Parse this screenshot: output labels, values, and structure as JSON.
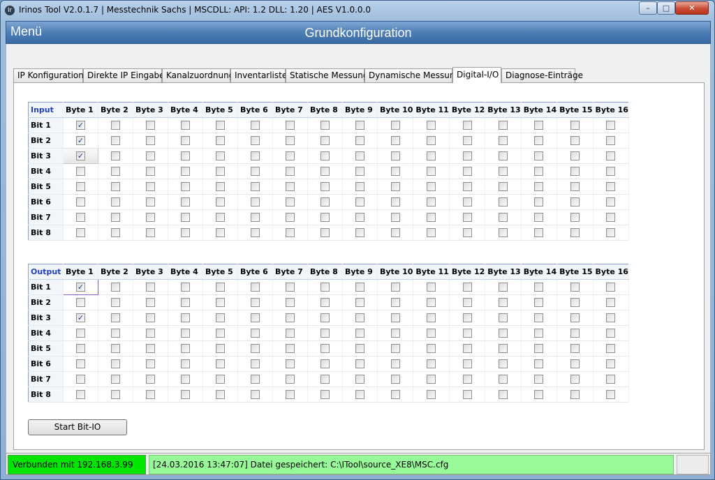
{
  "window": {
    "title": "Irinos Tool V2.0.1.7 | Messtechnik Sachs | MSCDLL: API: 1.2 DLL: 1.20 | AES V1.0.0.0",
    "icon_glyph": "Ir",
    "min_glyph": "–",
    "max_glyph": "□",
    "close_glyph": "✕"
  },
  "header": {
    "menu": "Menü",
    "title": "Grundkonfiguration"
  },
  "tabs": [
    {
      "label": "IP Konfiguration"
    },
    {
      "label": "Direkte IP Eingabe"
    },
    {
      "label": "Kanalzuordnung"
    },
    {
      "label": "Inventarliste"
    },
    {
      "label": "Statische Messung"
    },
    {
      "label": "Dynamische Messung"
    },
    {
      "label": "Digital-I/O"
    },
    {
      "label": "Diagnose-Einträge"
    }
  ],
  "active_tab": "Digital-I/O",
  "columns": [
    "Byte 1",
    "Byte 2",
    "Byte 3",
    "Byte 4",
    "Byte 5",
    "Byte 6",
    "Byte 7",
    "Byte 8",
    "Byte 9",
    "Byte 10",
    "Byte 11",
    "Byte 12",
    "Byte 13",
    "Byte 14",
    "Byte 15",
    "Byte 16"
  ],
  "rows": [
    "Bit 1",
    "Bit 2",
    "Bit 3",
    "Bit 4",
    "Bit 5",
    "Bit 6",
    "Bit 7",
    "Bit 8"
  ],
  "input": {
    "label": "Input",
    "checked": [
      [
        0,
        0
      ],
      [
        1,
        0
      ],
      [
        2,
        0
      ]
    ]
  },
  "output": {
    "label": "Output",
    "checked": [
      [
        0,
        0
      ],
      [
        2,
        0
      ]
    ]
  },
  "check_glyph": "✓",
  "start_button": "Start Bit-IO",
  "status": {
    "connection": "Verbunden mit 192.168.3.99",
    "message": "[24.03.2016 13:47:07] Datei gespeichert: C:\\ITool\\source_XE8\\MSC.cfg"
  },
  "colors": {
    "connected": "#00e600",
    "message_bg": "#98f998",
    "header_label": "#1f3fbf"
  }
}
